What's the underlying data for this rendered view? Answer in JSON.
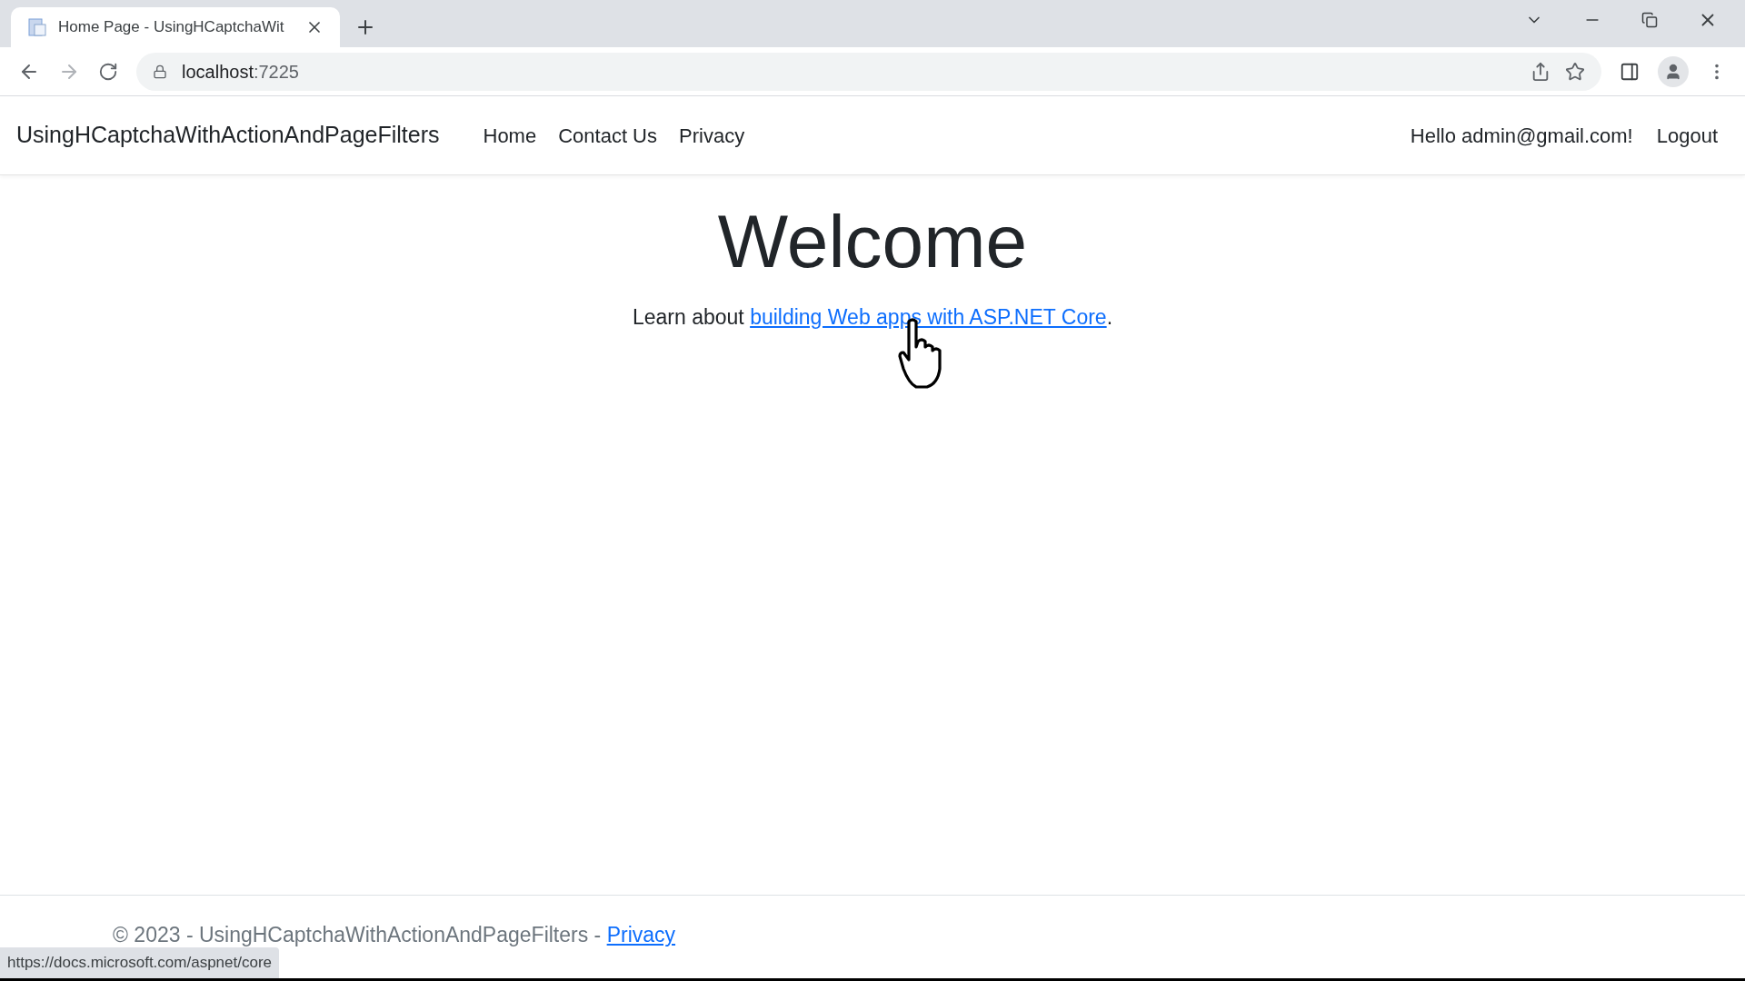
{
  "browser": {
    "tab": {
      "title": "Home Page - UsingHCaptchaWit",
      "selected": true
    },
    "address": {
      "host": "localhost",
      "port": ":7225"
    }
  },
  "navbar": {
    "brand": "UsingHCaptchaWithActionAndPageFilters",
    "links": [
      "Home",
      "Contact Us",
      "Privacy"
    ],
    "greeting": "Hello admin@gmail.com!",
    "logout": "Logout"
  },
  "main": {
    "heading": "Welcome",
    "intro": "Learn about ",
    "link": "building Web apps with ASP.NET Core",
    "after": "."
  },
  "footer": {
    "text": "© 2023 - UsingHCaptchaWithActionAndPageFilters - ",
    "link": "Privacy"
  },
  "status_bar": {
    "url": "https://docs.microsoft.com/aspnet/core"
  }
}
